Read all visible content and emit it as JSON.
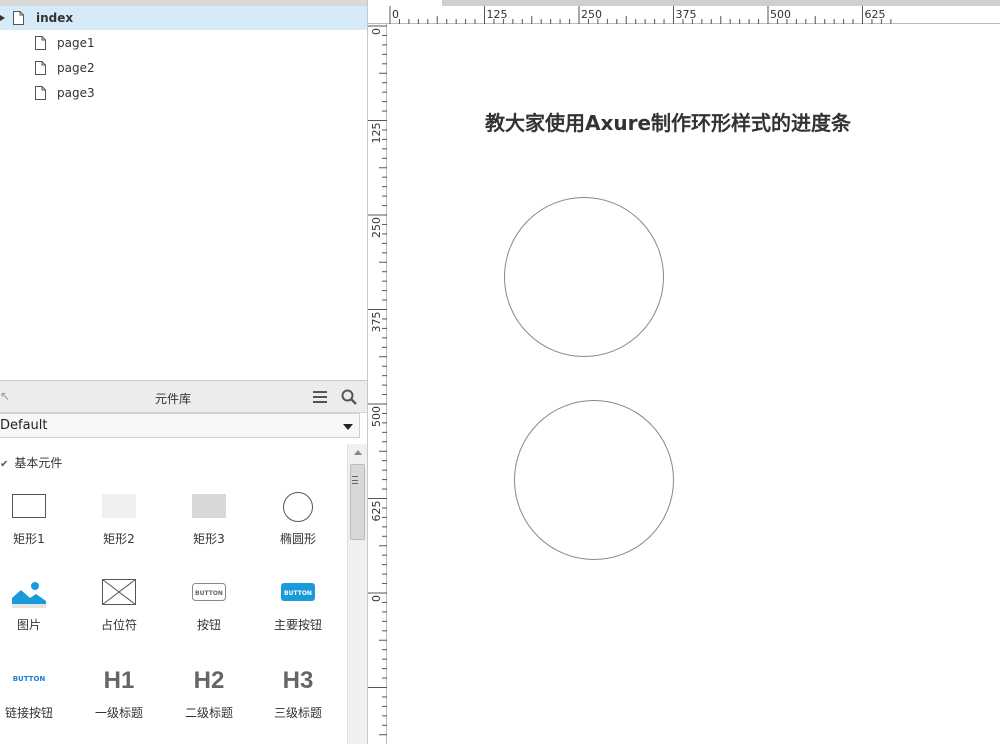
{
  "pages": {
    "items": [
      {
        "label": "index",
        "selected": true
      },
      {
        "label": "page1",
        "selected": false
      },
      {
        "label": "page2",
        "selected": false
      },
      {
        "label": "page3",
        "selected": false
      }
    ]
  },
  "library": {
    "title": "元件库",
    "selected_library": "Default",
    "group_label": "基本元件",
    "widgets": [
      {
        "label": "矩形1",
        "icon": "rectangle-outline-icon"
      },
      {
        "label": "矩形2",
        "icon": "rectangle-light-icon"
      },
      {
        "label": "矩形3",
        "icon": "rectangle-gray-icon"
      },
      {
        "label": "椭圆形",
        "icon": "ellipse-icon"
      },
      {
        "label": "图片",
        "icon": "image-icon"
      },
      {
        "label": "占位符",
        "icon": "placeholder-icon"
      },
      {
        "label": "按钮",
        "icon": "button-icon",
        "icon_text": "BUTTON"
      },
      {
        "label": "主要按钮",
        "icon": "primary-button-icon",
        "icon_text": "BUTTON"
      },
      {
        "label": "链接按钮",
        "icon": "link-button-icon",
        "icon_text": "BUTTON"
      },
      {
        "label": "一级标题",
        "icon": "h1-icon",
        "icon_text": "H1"
      },
      {
        "label": "二级标题",
        "icon": "h2-icon",
        "icon_text": "H2"
      },
      {
        "label": "三级标题",
        "icon": "h3-icon",
        "icon_text": "H3"
      }
    ]
  },
  "ruler": {
    "top_labels": [
      "0",
      "125",
      "250",
      "375",
      "500",
      "625"
    ],
    "left_labels": [
      "0",
      "125",
      "250",
      "375",
      "500",
      "625",
      "0"
    ]
  },
  "canvas": {
    "title": "教大家使用Axure制作环形样式的进度条"
  },
  "colors": {
    "selection": "#d6ebf7",
    "primary_button": "#1a9ad9",
    "link_button_text": "#1a7fd4"
  }
}
